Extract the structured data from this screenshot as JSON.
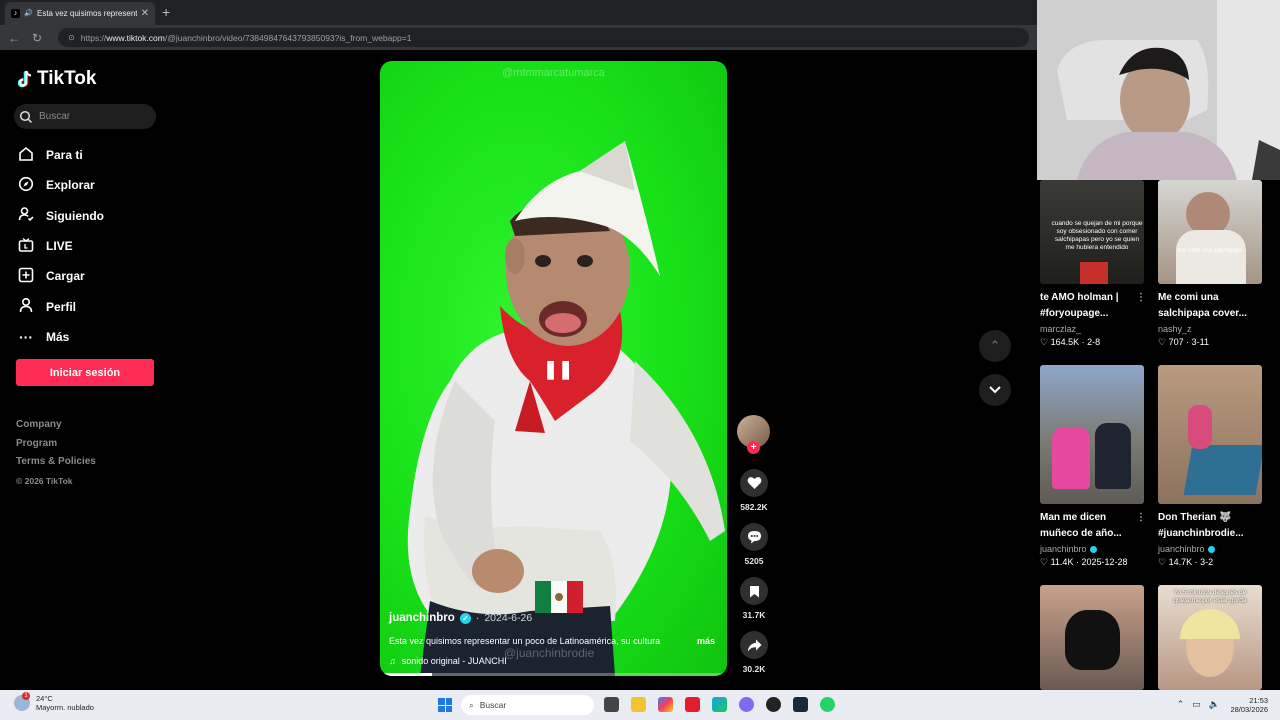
{
  "browser": {
    "tab_title": "Esta vez quisimos representar",
    "tab_favicon": "tiktok-icon",
    "url_prefix": "https://",
    "url_domain": "www.tiktok.com",
    "url_path": "/@juanchinbro/video/7384984764379385093?is_from_webapp=1"
  },
  "sidebar": {
    "logo": "TikTok",
    "search_placeholder": "Buscar",
    "nav": [
      {
        "label": "Para ti",
        "icon": "home-icon"
      },
      {
        "label": "Explorar",
        "icon": "compass-icon"
      },
      {
        "label": "Siguiendo",
        "icon": "following-icon"
      },
      {
        "label": "LIVE",
        "icon": "live-icon"
      },
      {
        "label": "Cargar",
        "icon": "upload-icon"
      },
      {
        "label": "Perfil",
        "icon": "profile-icon"
      },
      {
        "label": "Más",
        "icon": "more-icon"
      }
    ],
    "login_button": "Iniciar sesión",
    "footer": {
      "company": "Company",
      "program": "Program",
      "terms": "Terms & Policies",
      "copyright": "© 2026 TikTok"
    }
  },
  "video": {
    "watermark": "@mtmmarcatumarca",
    "sub_watermark": "@juanchinbrodie",
    "author": "juanchinbro",
    "date": "2024-6-26",
    "description": "Esta vez quisimos representar un poco de Latinoamérica, su cultura",
    "more": "más",
    "sound": "sonido original - JUANCHI",
    "progress": 0.15
  },
  "actions": {
    "likes": "582.2K",
    "comments": "5205",
    "saves": "31.7K",
    "shares": "30.2K"
  },
  "recommended": [
    {
      "title": "te AMO holman | #foryoupage...",
      "author": "marczlaz_",
      "verified": false,
      "likes": "164.5K",
      "date": "2-8",
      "thumb_text": "cuando se quejan de mi porque soy obsesionado con comer salchipapas pero yo se quien me hubiera entendido"
    },
    {
      "title": "Me comi una salchipapa cover...",
      "author": "nashy_z",
      "verified": false,
      "likes": "707",
      "date": "3-11",
      "thumb_text": "me comi una salchipapa"
    },
    {
      "title": "Man me dicen muñeco de año...",
      "author": "juanchinbro",
      "verified": true,
      "likes": "11.4K",
      "date": "2025-12-28",
      "thumb_text": ""
    },
    {
      "title": "Don Therian 🐺 #juanchinbrodie...",
      "author": "juanchinbro",
      "verified": true,
      "likes": "14.7K",
      "date": "3-2",
      "thumb_text": ""
    },
    {
      "title": "",
      "author": "",
      "verified": false,
      "likes": "",
      "date": "",
      "thumb_text": ""
    },
    {
      "title": "",
      "author": "",
      "verified": false,
      "likes": "",
      "date": "",
      "thumb_text": "Yo 5 minutos después de quejarme por estar gorda"
    }
  ],
  "taskbar": {
    "temp": "24°C",
    "weather": "Mayorm. nublado",
    "weather_badge": "1",
    "search_placeholder": "Buscar",
    "time": "21:53",
    "date": "28/03/2026"
  },
  "colors": {
    "accent": "#fe2c55",
    "verified": "#20d5ec",
    "video_bg": "#1fe01f"
  }
}
